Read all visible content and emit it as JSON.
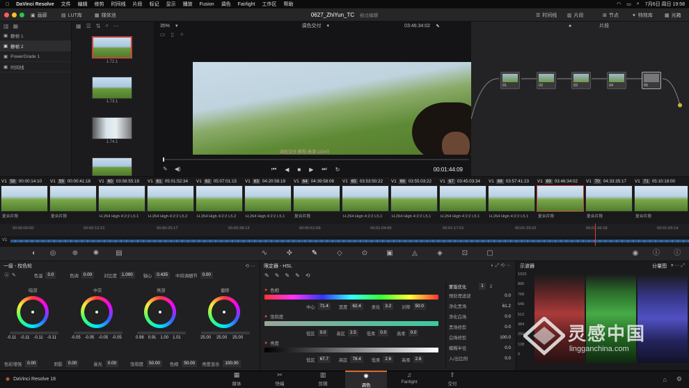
{
  "menubar": {
    "app": "DaVinci Resolve",
    "items": [
      "文件",
      "编辑",
      "修剪",
      "时间线",
      "片段",
      "标记",
      "显示",
      "播放",
      "Fusion",
      "调色",
      "Fairlight",
      "工作区",
      "帮助"
    ],
    "clock": "7月6日 周日  19:58"
  },
  "toolbar": {
    "gallery": "画廊",
    "lut": "LUT库",
    "media": "媒体池",
    "project_title": "0627_ZhiYun_TC",
    "edited": "经过编辑",
    "timeline": "时间线",
    "clip": "片段",
    "nodes": "节点",
    "effects": "特效库",
    "lightbox": "光箱",
    "zoom": "35%",
    "grade_mode": "调色交付",
    "timecode": "03:46:34:02",
    "clip_label": "片段"
  },
  "stills": {
    "albums": [
      "静帧 1",
      "静帧 2",
      "PowerGrade 1",
      "时间线"
    ],
    "thumbs": [
      "1.72.1",
      "1.73.1",
      "1.74.1"
    ]
  },
  "viewer": {
    "overlay_text": "调色交付·教程·高清 LIGHT",
    "playback_tc": "00:01:44:09"
  },
  "nodes": [
    "01",
    "02",
    "03",
    "04",
    "05"
  ],
  "clips": [
    {
      "n": "58",
      "tc": "00:00:14:10",
      "v": "V1",
      "codec": "复合片段"
    },
    {
      "n": "59",
      "tc": "00:00:41:18",
      "v": "V1",
      "codec": "复合片段"
    },
    {
      "n": "60",
      "tc": "03:58:55:19",
      "v": "V1",
      "codec": "H.264 High 4:2:2 L5.1"
    },
    {
      "n": "61",
      "tc": "05:01:52:34",
      "v": "V1",
      "codec": "H.264 High 4:2:2 L5.2"
    },
    {
      "n": "62",
      "tc": "05:07:01:15",
      "v": "V1",
      "codec": "H.264 High 4:2:2 L5.2"
    },
    {
      "n": "63",
      "tc": "04:20:58:19",
      "v": "V1",
      "codec": "H.264 High 4:2:2 L5.1"
    },
    {
      "n": "64",
      "tc": "04:39:58:06",
      "v": "V1",
      "codec": "复合片段"
    },
    {
      "n": "65",
      "tc": "03:53:50:22",
      "v": "V1",
      "codec": "H.264 High 4:2:2 L5.1"
    },
    {
      "n": "66",
      "tc": "03:55:03:22",
      "v": "V1",
      "codec": "H.264 High 4:2:2 L5.1"
    },
    {
      "n": "67",
      "tc": "03:45:03:34",
      "v": "V1",
      "codec": "H.264 High 4:2:2 L5.1"
    },
    {
      "n": "68",
      "tc": "03:57:41:23",
      "v": "V1",
      "codec": "H.264 High 4:2:2 L5.1"
    },
    {
      "n": "69",
      "tc": "03:46:34:02",
      "v": "V1",
      "codec": "复合片段"
    },
    {
      "n": "70",
      "tc": "04:33:35:17",
      "v": "V1",
      "codec": "复合片段"
    },
    {
      "n": "71",
      "tc": "05:10:18:00",
      "v": "V1",
      "codec": "复合片段"
    }
  ],
  "ruler": [
    "00:00:00:00",
    "00:00:12:21",
    "00:00:25:17",
    "00:00:38:13",
    "00:00:51:09",
    "00:01:04:05",
    "00:01:17:01",
    "00:01:29:22",
    "00:01:42:18",
    "00:01:55:14"
  ],
  "track_label": "V1",
  "wheels": {
    "title": "一级 - 校色轮",
    "temp_label": "色温",
    "temp": "0.0",
    "tint_label": "色调",
    "tint": "0.00",
    "contrast_label": "对比度",
    "contrast": "1.000",
    "pivot_label": "轴心",
    "pivot": "0.435",
    "mid_label": "中间调细节",
    "mid": "0.00",
    "names": [
      "暗部",
      "中灰",
      "亮部",
      "偏移"
    ],
    "values": [
      [
        "-0.11",
        "-0.11",
        "-0.11",
        "-0.11"
      ],
      [
        "-0.05",
        "-0.05",
        "-0.05",
        "-0.05"
      ],
      [
        "0.98",
        "0.91",
        "1.00",
        "1.01"
      ],
      [
        "25.00",
        "25.00",
        "25.00"
      ]
    ],
    "bottom": [
      {
        "l": "色彩增强",
        "v": "0.00"
      },
      {
        "l": "阴影",
        "v": "0.00"
      },
      {
        "l": "高光",
        "v": "0.00"
      },
      {
        "l": "饱和度",
        "v": "50.00"
      },
      {
        "l": "色相",
        "v": "50.00"
      },
      {
        "l": "亮度混合",
        "v": "100.00"
      }
    ]
  },
  "hsl": {
    "title": "限定器 - HSL",
    "hue_label": "色相",
    "hue": [
      {
        "l": "中心",
        "v": "71.4"
      },
      {
        "l": "宽度",
        "v": "62.4"
      },
      {
        "l": "柔化",
        "v": "3.2"
      },
      {
        "l": "对称",
        "v": "50.0"
      }
    ],
    "sat_label": "饱和度",
    "sat": [
      {
        "l": "低区",
        "v": "0.0"
      },
      {
        "l": "高区",
        "v": "2.5"
      },
      {
        "l": "低柔",
        "v": "0.0"
      },
      {
        "l": "高柔",
        "v": "0.0"
      }
    ],
    "lum_label": "亮度",
    "lum": [
      {
        "l": "低区",
        "v": "67.7"
      },
      {
        "l": "高区",
        "v": "78.4"
      },
      {
        "l": "低柔",
        "v": "2.6"
      },
      {
        "l": "高柔",
        "v": "2.6"
      }
    ],
    "refine_title": "蒙版优化",
    "refine_tabs": [
      "1",
      "2"
    ],
    "refine": [
      {
        "l": "预处理滤波",
        "v": "0.0"
      },
      {
        "l": "净化黑场",
        "v": "61.2"
      },
      {
        "l": "净化白场",
        "v": "0.0"
      },
      {
        "l": "黑场修剪",
        "v": "0.0"
      },
      {
        "l": "白场修剪",
        "v": "100.0"
      },
      {
        "l": "模糊半径",
        "v": "0.0"
      },
      {
        "l": "入/出比例",
        "v": "0.0"
      }
    ]
  },
  "scope": {
    "title": "示波器",
    "mode": "分量图",
    "scale": [
      "1023",
      "896",
      "768",
      "640",
      "512",
      "384",
      "256",
      "128",
      "0"
    ]
  },
  "pages": [
    "媒体",
    "快编",
    "剪辑",
    "调色",
    "Fairlight",
    "交付"
  ],
  "bottom_app": "DaVinci Resolve 18",
  "watermark": {
    "cn": "灵感中国",
    "url": "lingganchina.com"
  },
  "colors": {
    "accent": "#e06a2a",
    "selected": "#c8443c",
    "track": "#3c73b0"
  }
}
